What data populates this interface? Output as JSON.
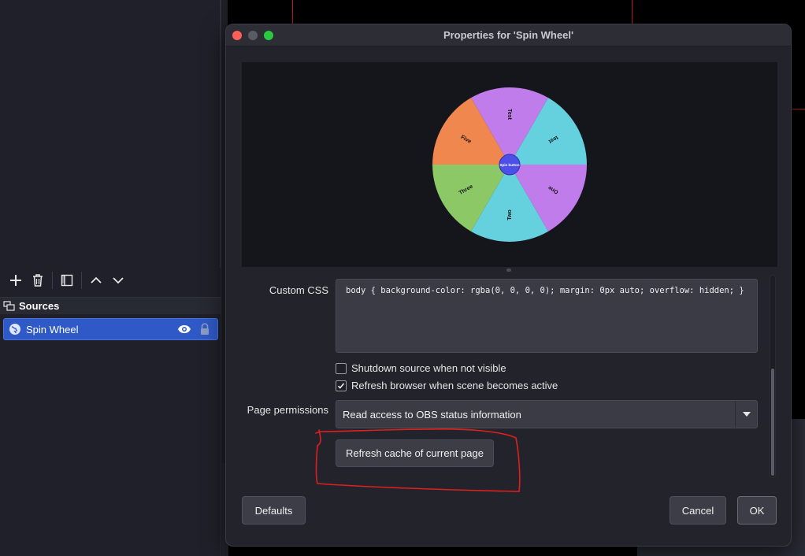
{
  "dialog": {
    "title": "Properties for 'Spin Wheel'"
  },
  "wheel": {
    "center_label": "Spin button",
    "segments": [
      {
        "label": "Test",
        "color": "#c17ceb"
      },
      {
        "label": "test",
        "color": "#65d1df"
      },
      {
        "label": "One",
        "color": "#c17ceb"
      },
      {
        "label": "Two",
        "color": "#65d1df"
      },
      {
        "label": "Three",
        "color": "#8cc966"
      },
      {
        "label": "Five",
        "color": "#f0874f"
      }
    ],
    "center_color": "#4c4fe8"
  },
  "form": {
    "custom_css_label": "Custom CSS",
    "custom_css_value": "body { background-color: rgba(0, 0, 0, 0); margin: 0px auto; overflow: hidden; }",
    "shutdown_label": "Shutdown source when not visible",
    "shutdown_checked": false,
    "refresh_label": "Refresh browser when scene becomes active",
    "refresh_checked": true,
    "permissions_label": "Page permissions",
    "permissions_value": "Read access to OBS status information",
    "refresh_cache_label": "Refresh cache of current page"
  },
  "buttons": {
    "defaults": "Defaults",
    "cancel": "Cancel",
    "ok": "OK"
  },
  "sources": {
    "header": "Sources",
    "items": [
      {
        "label": "Spin Wheel"
      }
    ]
  },
  "colors": {
    "selection": "#2f59c6",
    "annotation": "#e02020"
  }
}
